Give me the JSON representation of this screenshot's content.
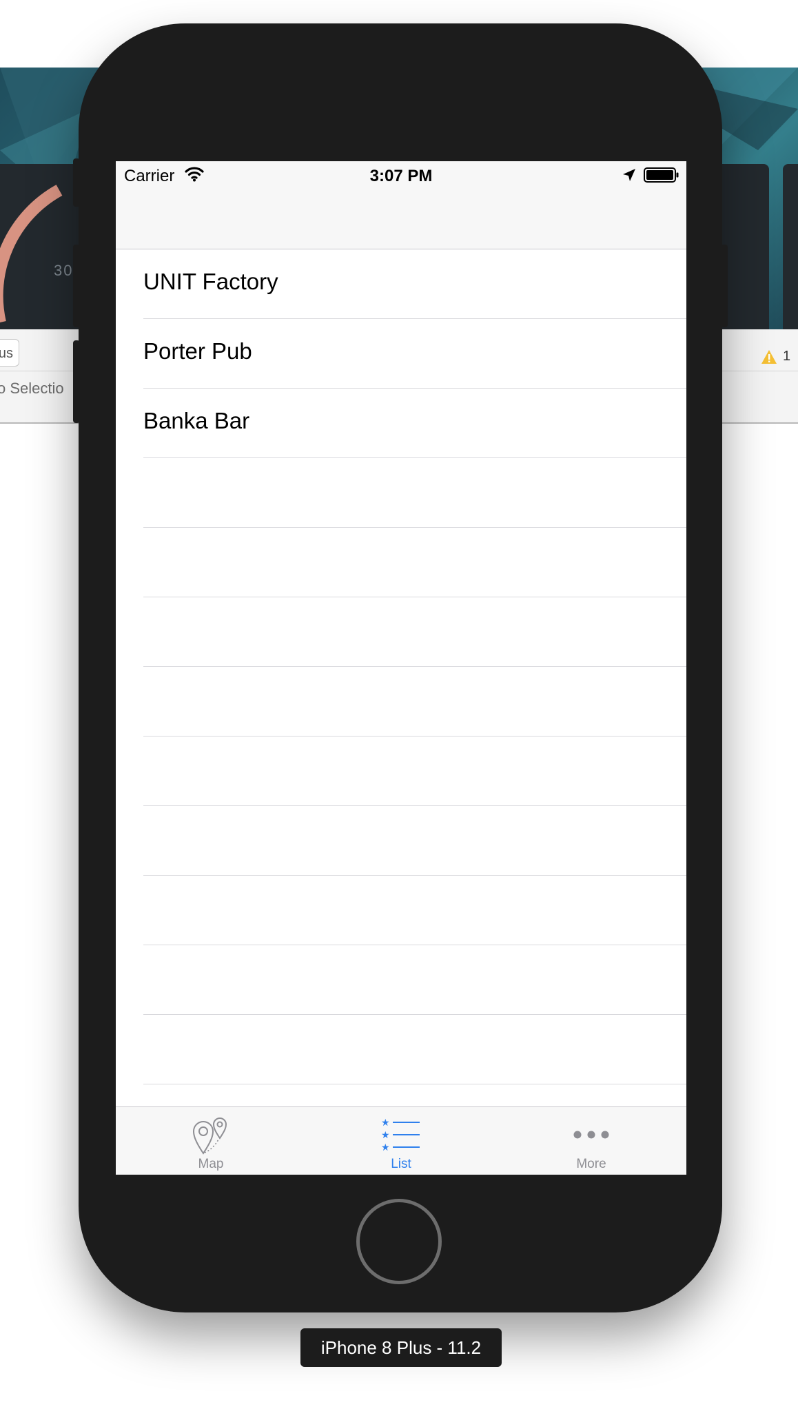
{
  "background_window": {
    "scheme_button_text": "us",
    "no_selection_text": "o Selectio",
    "donut_value_text": "30",
    "warning_count": "1"
  },
  "status_bar": {
    "carrier": "Carrier",
    "time": "3:07 PM"
  },
  "list": {
    "items": [
      {
        "label": "UNIT Factory"
      },
      {
        "label": "Porter Pub"
      },
      {
        "label": "Banka Bar"
      }
    ]
  },
  "tab_bar": {
    "tabs": [
      {
        "label": "Map",
        "icon": "map-pins-icon",
        "selected": false
      },
      {
        "label": "List",
        "icon": "starred-list-icon",
        "selected": true
      },
      {
        "label": "More",
        "icon": "more-dots-icon",
        "selected": false
      }
    ],
    "active_color": "#2f80ed",
    "inactive_color": "#8e8e93"
  },
  "device_label": "iPhone 8 Plus - 11.2"
}
